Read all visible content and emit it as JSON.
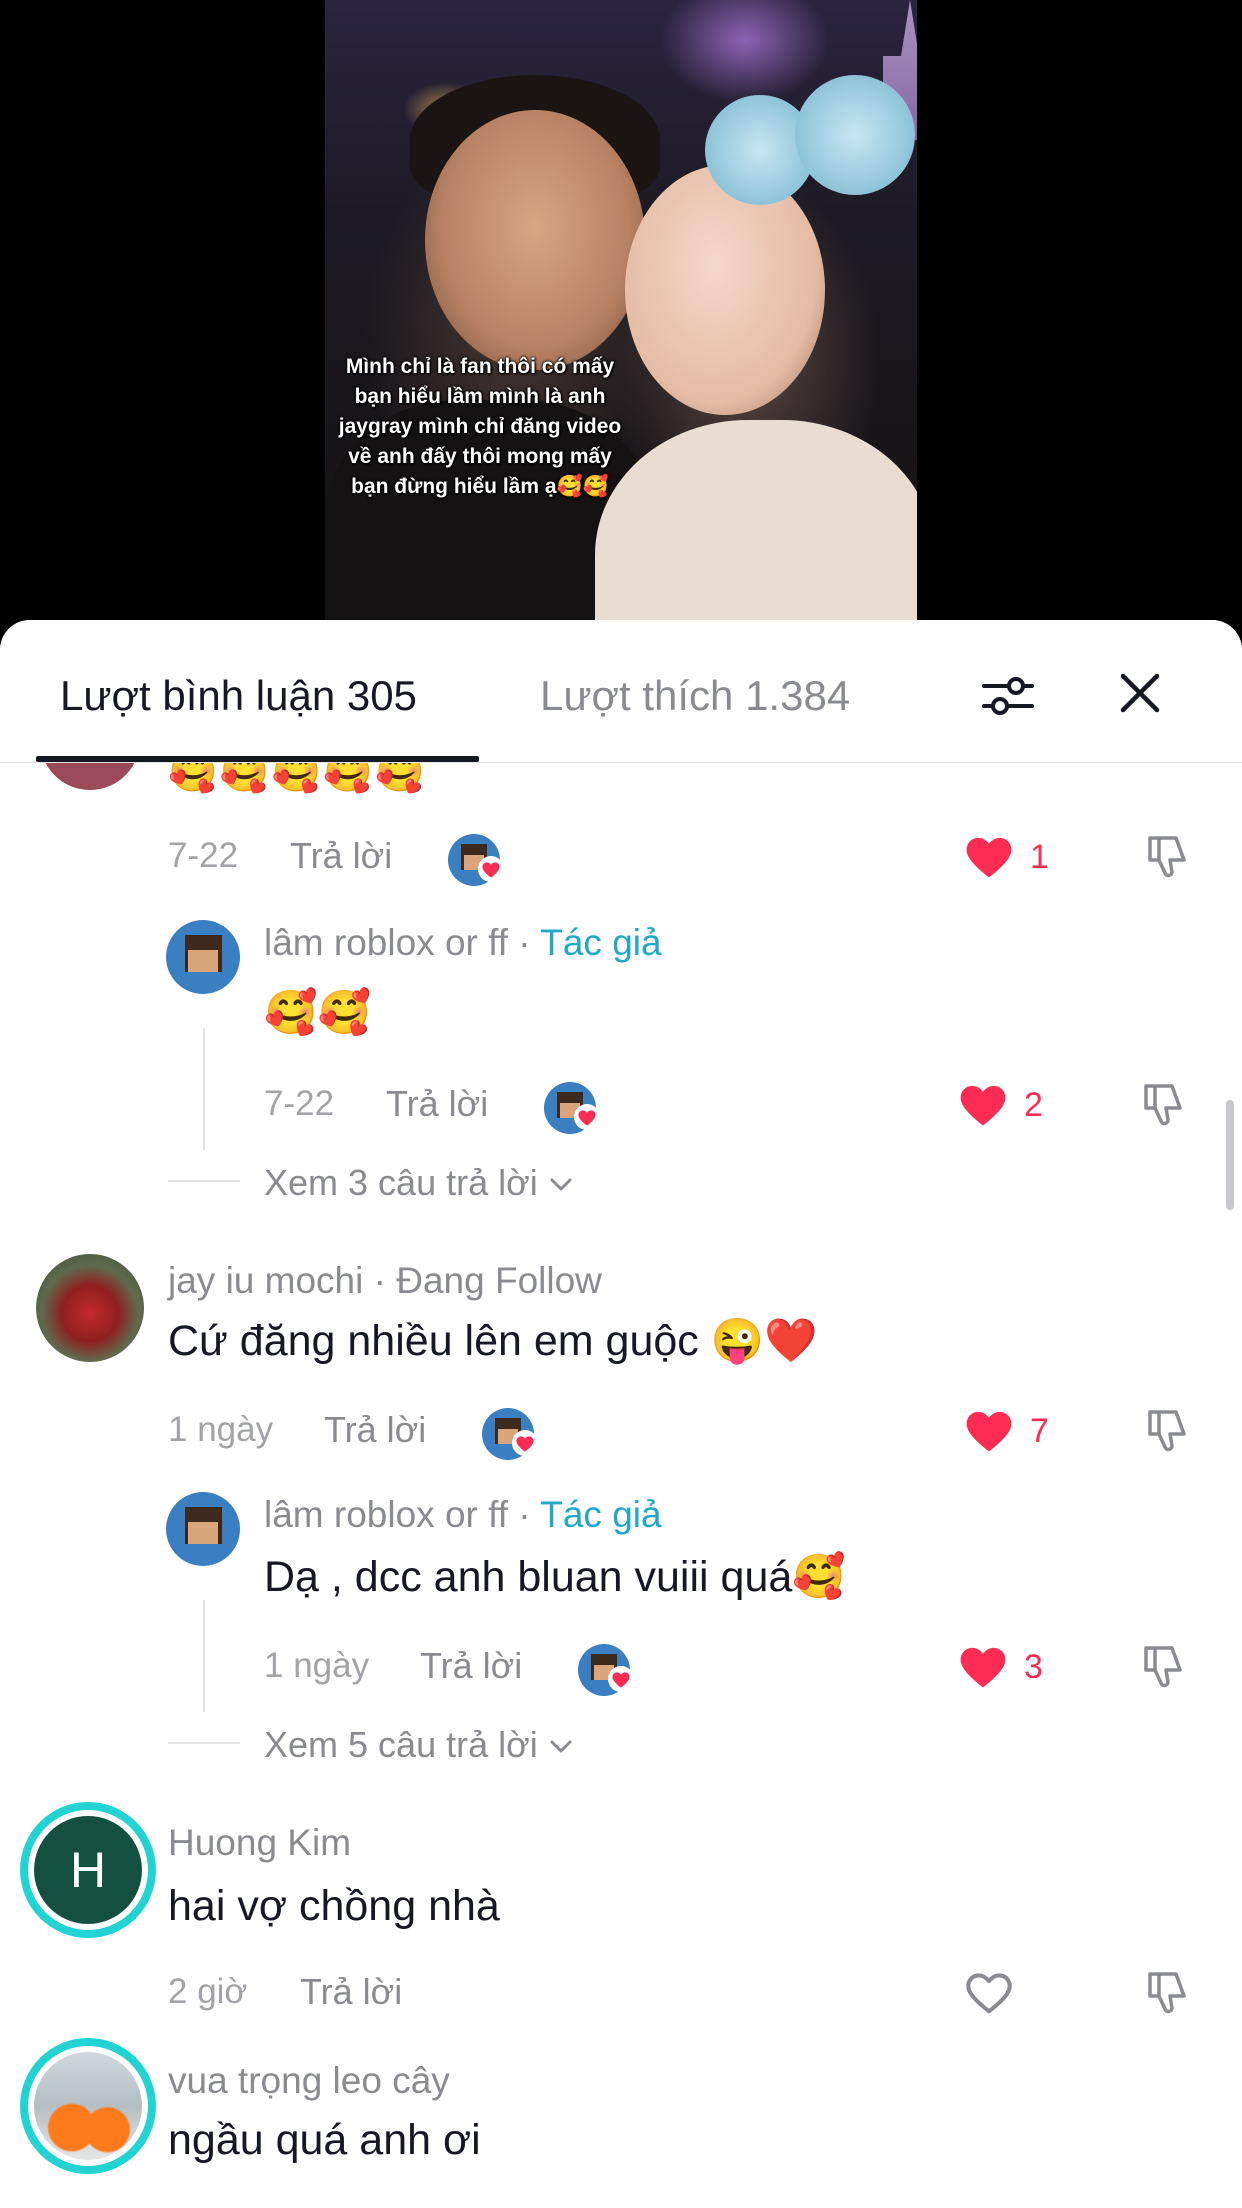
{
  "video": {
    "caption_lines": [
      "Mình chỉ là fan thôi có  mấy",
      "bạn hiểu lầm mình là anh",
      "jaygray mình chỉ đăng video",
      "về anh đấy thôi mong mấy",
      "bạn đừng hiểu lầm ạ🥰🥰"
    ]
  },
  "tabs": {
    "comments": "Lượt bình luận 305",
    "likes": "Lượt thích 1.384"
  },
  "icons": {
    "filter": "filter-sliders-icon",
    "close": "close-icon",
    "like": "heart-icon",
    "dislike": "dislike-icon"
  },
  "colors": {
    "accent": "#fe2c55",
    "author": "#20a8c8",
    "text": "#161823",
    "muted": "#8a8b91"
  },
  "comments": [
    {
      "partial_text": "🥰🥰🥰🥰🥰",
      "date": "7-22",
      "reply_label": "Trả lời",
      "likes": "1",
      "liked": true,
      "reply": {
        "author": "lâm roblox or ff",
        "author_tag": "Tác giả",
        "text": "🥰🥰",
        "date": "7-22",
        "reply_label": "Trả lời",
        "likes": "2"
      },
      "view_more": "Xem 3 câu trả lời"
    },
    {
      "author": "jay iu mochi",
      "author_tag": "Đang Follow",
      "text": "Cứ đăng nhiều lên em guộc 😜❤️",
      "date": "1 ngày",
      "reply_label": "Trả lời",
      "likes": "7",
      "liked": true,
      "reply": {
        "author": "lâm roblox or ff",
        "author_tag": "Tác giả",
        "text": "Dạ , dcc anh bluan vuiii quá🥰",
        "date": "1 ngày",
        "reply_label": "Trả lời",
        "likes": "3"
      },
      "view_more": "Xem 5 câu trả lời"
    },
    {
      "author": "Huong Kim",
      "avatar_letter": "H",
      "text": "hai vợ chồng nhà",
      "date": "2 giờ",
      "reply_label": "Trả lời",
      "liked": false
    },
    {
      "author": "vua trọng leo cây",
      "text": "ngầu quá anh ơi"
    }
  ]
}
